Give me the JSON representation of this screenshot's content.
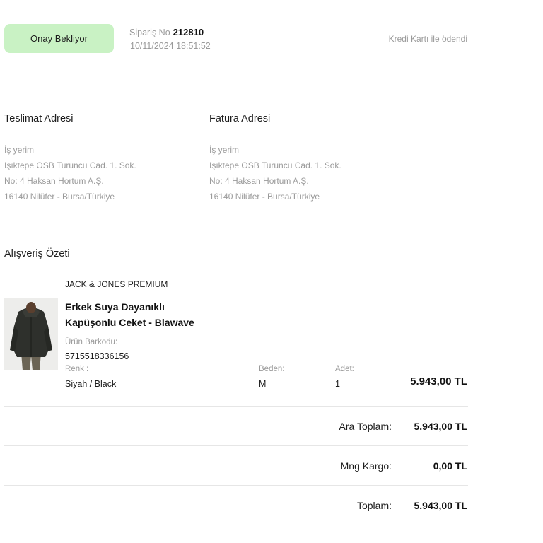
{
  "order": {
    "status": "Onay Bekliyor",
    "number_label": "Sipariş No",
    "number": "212810",
    "date": "10/11/2024 18:51:52",
    "payment_info": "Kredi Kartı ile ödendi"
  },
  "delivery_address": {
    "title": "Teslimat Adresi",
    "lines": [
      "İş yerim",
      "Işıktepe OSB Turuncu Cad. 1. Sok.",
      "No: 4 Haksan Hortum A.Ş.",
      "16140 Nilüfer - Bursa/Türkiye"
    ]
  },
  "billing_address": {
    "title": "Fatura Adresi",
    "lines": [
      "İş yerim",
      "Işıktepe OSB Turuncu Cad. 1. Sok.",
      "No: 4 Haksan Hortum A.Ş.",
      "16140 Nilüfer - Bursa/Türkiye"
    ]
  },
  "summary": {
    "title": "Alışveriş Özeti",
    "item": {
      "brand": "JACK & JONES PREMIUM",
      "name_line1": "Erkek Suya Dayanıklı",
      "name_line2": "Kapüşonlu Ceket - Blawave",
      "barcode_label": "Ürün Barkodu:",
      "barcode": "5715518336156",
      "color_label": "Renk :",
      "color": "Siyah / Black",
      "size_label": "Beden:",
      "size": "M",
      "qty_label": "Adet:",
      "qty": "1",
      "price": "5.943,00 TL"
    },
    "subtotal_label": "Ara Toplam:",
    "subtotal": "5.943,00 TL",
    "shipping_label": "Mng Kargo:",
    "shipping": "0,00 TL",
    "total_label": "Toplam:",
    "total": "5.943,00 TL"
  },
  "colors": {
    "status_badge_bg": "#c9f2c4",
    "muted_text": "#9a9a9a",
    "divider": "#e6e6e6"
  }
}
